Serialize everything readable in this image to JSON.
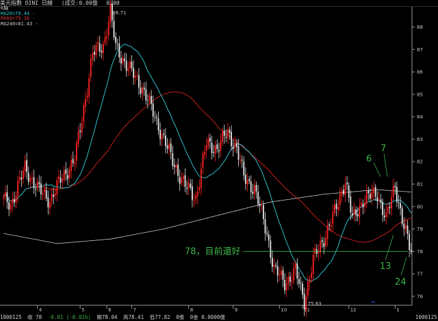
{
  "header": {
    "index_name": "美元指數 DINI 日線",
    "volume_info": "(成交:0.00億",
    "volume_value": "0.00"
  },
  "legend": {
    "title": "K線",
    "ma20": "MA20=79.44 -",
    "ma60": "MA60=79.36 -",
    "ma240": "MA240=81.43 -"
  },
  "colors": {
    "background": "#000000",
    "up": "#ff2222",
    "down": "#e6e6e6",
    "ma20": "#2fc0cc",
    "ma60": "#c81e1e",
    "ma240": "#c8c8c8",
    "annotation": "#3cb44b",
    "axis": "#9a9a9a"
  },
  "annotations": {
    "high_label": "88.71",
    "low_label": "75.63",
    "level_text": "78，目前還好",
    "wave_6": "6",
    "wave_7": "7",
    "wave_13": "13",
    "wave_24": "24",
    "caret": "^"
  },
  "status": {
    "date": "1000125",
    "close": "收 78",
    "change": "-0.01 (-0.01%)",
    "open": "開78.04",
    "high": "高78.41",
    "low": "低77.82",
    "zero1": "0張",
    "zero2": "0金 0.0000億"
  },
  "right_label": "1000125",
  "chart_data": {
    "type": "candlestick",
    "ylim": [
      75.6,
      88.9
    ],
    "y_ticks": [
      "88",
      "87",
      "86",
      "85",
      "84",
      "83",
      "82",
      "81",
      "80",
      "79",
      "78",
      "77",
      "76"
    ],
    "x_ticks": [
      "4",
      "5",
      "6",
      "7",
      "8",
      "9",
      "10",
      "11",
      "12",
      "1"
    ],
    "x_tick_index": [
      19,
      43,
      58,
      72,
      104,
      129,
      155,
      168,
      194,
      220
    ],
    "bars": 230,
    "anchors": [
      [
        0,
        80.3
      ],
      [
        4,
        80.1
      ],
      [
        12,
        81.7
      ],
      [
        20,
        80.7
      ],
      [
        26,
        80.3
      ],
      [
        33,
        81.3
      ],
      [
        40,
        82.1
      ],
      [
        44,
        83.9
      ],
      [
        50,
        86.8
      ],
      [
        56,
        87.2
      ],
      [
        60,
        88.7
      ],
      [
        63,
        87.1
      ],
      [
        70,
        86.2
      ],
      [
        78,
        85.3
      ],
      [
        86,
        83.8
      ],
      [
        94,
        82.2
      ],
      [
        102,
        80.9
      ],
      [
        108,
        80.4
      ],
      [
        114,
        82.8
      ],
      [
        120,
        82.6
      ],
      [
        126,
        83.3
      ],
      [
        131,
        82.6
      ],
      [
        135,
        81.3
      ],
      [
        141,
        80.8
      ],
      [
        148,
        78.8
      ],
      [
        152,
        77.2
      ],
      [
        158,
        76.6
      ],
      [
        164,
        77.1
      ],
      [
        169,
        75.8
      ],
      [
        174,
        77.6
      ],
      [
        180,
        78.6
      ],
      [
        186,
        79.7
      ],
      [
        192,
        81.2
      ],
      [
        196,
        79.4
      ],
      [
        202,
        80.3
      ],
      [
        210,
        80.6
      ],
      [
        215,
        79.4
      ],
      [
        220,
        81.0
      ],
      [
        224,
        79.4
      ],
      [
        228,
        78.2
      ],
      [
        229,
        78.0
      ]
    ],
    "level_line": 78,
    "ma240_points": [
      [
        0,
        78.8
      ],
      [
        30,
        78.35
      ],
      [
        60,
        78.55
      ],
      [
        90,
        79.0
      ],
      [
        120,
        79.6
      ],
      [
        150,
        80.2
      ],
      [
        180,
        80.55
      ],
      [
        210,
        80.75
      ],
      [
        229,
        80.65
      ]
    ]
  }
}
